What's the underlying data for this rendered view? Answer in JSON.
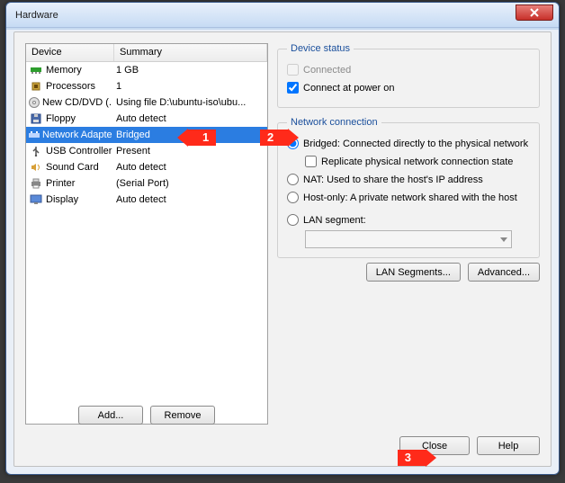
{
  "window": {
    "title": "Hardware"
  },
  "columns": {
    "device": "Device",
    "summary": "Summary"
  },
  "devices": [
    {
      "name": "Memory",
      "summary": "1 GB",
      "icon": "memory"
    },
    {
      "name": "Processors",
      "summary": "1",
      "icon": "cpu"
    },
    {
      "name": "New CD/DVD (...",
      "summary": "Using file D:\\ubuntu-iso\\ubu...",
      "icon": "cd"
    },
    {
      "name": "Floppy",
      "summary": "Auto detect",
      "icon": "floppy"
    },
    {
      "name": "Network Adapter",
      "summary": "Bridged",
      "icon": "nic",
      "selected": true
    },
    {
      "name": "USB Controller",
      "summary": "Present",
      "icon": "usb"
    },
    {
      "name": "Sound Card",
      "summary": "Auto detect",
      "icon": "sound"
    },
    {
      "name": "Printer",
      "summary": "(Serial Port)",
      "icon": "printer"
    },
    {
      "name": "Display",
      "summary": "Auto detect",
      "icon": "display"
    }
  ],
  "buttons": {
    "add": "Add...",
    "remove": "Remove",
    "lanSegments": "LAN Segments...",
    "advanced": "Advanced...",
    "close": "Close",
    "help": "Help"
  },
  "deviceStatus": {
    "legend": "Device status",
    "connected": "Connected",
    "connectedChecked": false,
    "connectedEnabled": false,
    "connectAtPowerOn": "Connect at power on",
    "connectAtPowerOnChecked": true
  },
  "networkConnection": {
    "legend": "Network connection",
    "bridged": "Bridged: Connected directly to the physical network",
    "replicate": "Replicate physical network connection state",
    "replicateChecked": false,
    "nat": "NAT: Used to share the host's IP address",
    "hostOnly": "Host-only: A private network shared with the host",
    "lanSegment": "LAN segment:",
    "selected": "bridged"
  },
  "annotations": {
    "one": "1",
    "two": "2",
    "three": "3"
  }
}
